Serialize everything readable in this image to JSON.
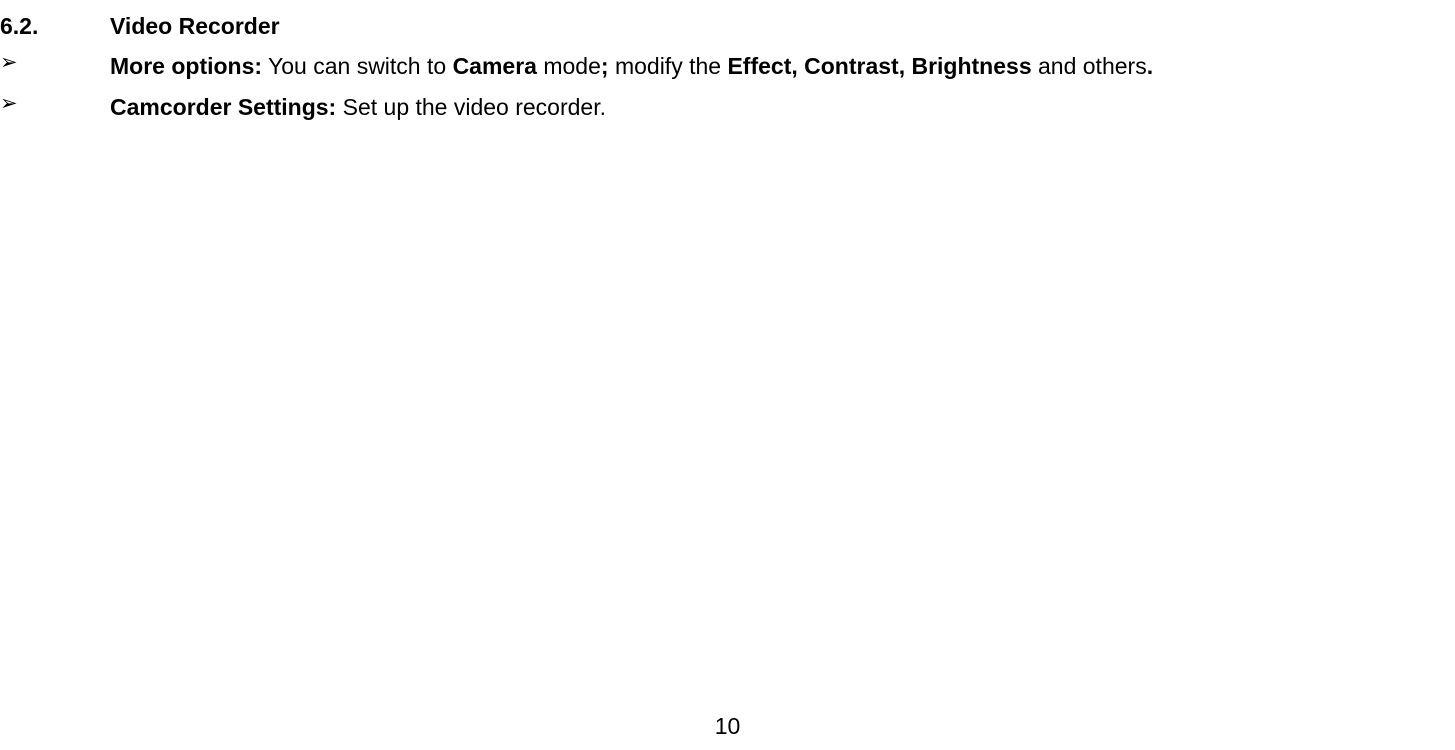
{
  "heading": {
    "number": "6.2.",
    "title": "Video Recorder"
  },
  "bullets": [
    {
      "label": "More options:",
      "text_before": " You can switch to ",
      "bold1": "Camera",
      "text_mid1": " mode",
      "bold2": ";",
      "text_mid2": " modify the ",
      "bold3": "Effect, Contrast, Brightness",
      "text_after": " and others",
      "bold4": "."
    },
    {
      "label": "Camcorder Settings:",
      "text": " Set up the video recorder."
    }
  ],
  "page_number": "10",
  "bullet_marker": "➢"
}
